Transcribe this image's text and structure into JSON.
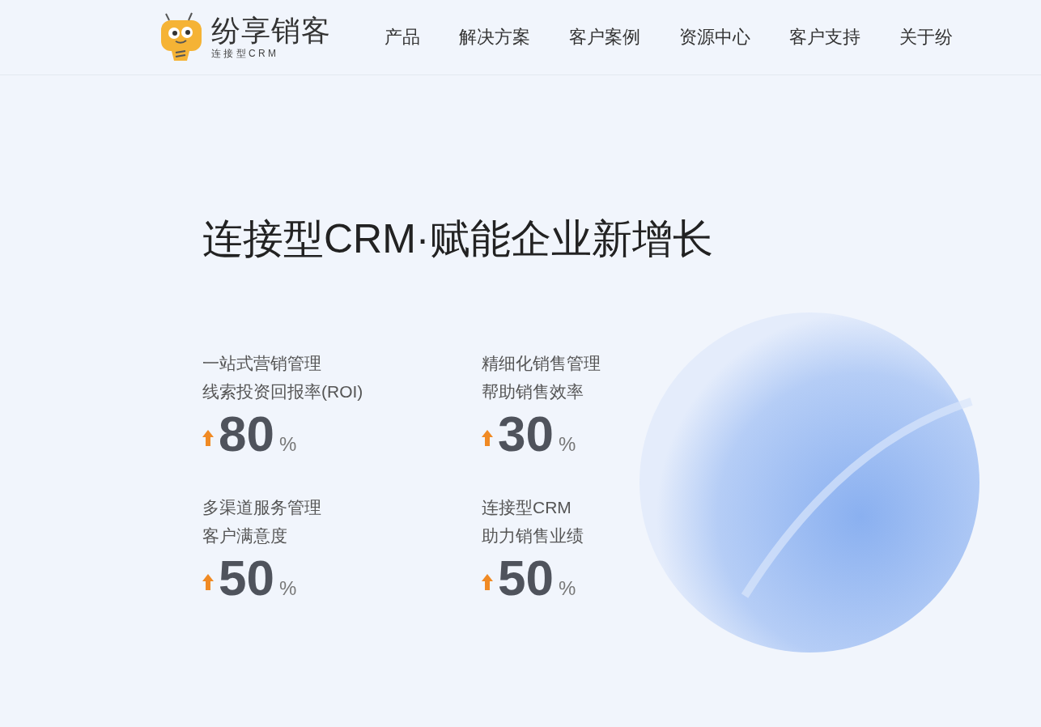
{
  "header": {
    "logo": {
      "name": "纷享销客",
      "tagline": "连 接 型 C R M"
    },
    "nav": [
      {
        "label": "产品"
      },
      {
        "label": "解决方案"
      },
      {
        "label": "客户案例"
      },
      {
        "label": "资源中心"
      },
      {
        "label": "客户支持"
      },
      {
        "label": "关于纷"
      }
    ]
  },
  "hero": {
    "title": "连接型CRM·赋能企业新增长",
    "stats": [
      {
        "line1": "一站式营销管理",
        "line2": "线索投资回报率(ROI)",
        "value": "80",
        "unit": "%"
      },
      {
        "line1": "精细化销售管理",
        "line2": "帮助销售效率",
        "value": "30",
        "unit": "%"
      },
      {
        "line1": "多渠道服务管理",
        "line2": "客户满意度",
        "value": "50",
        "unit": "%"
      },
      {
        "line1": "连接型CRM",
        "line2": "助力销售业绩",
        "value": "50",
        "unit": "%"
      }
    ]
  }
}
